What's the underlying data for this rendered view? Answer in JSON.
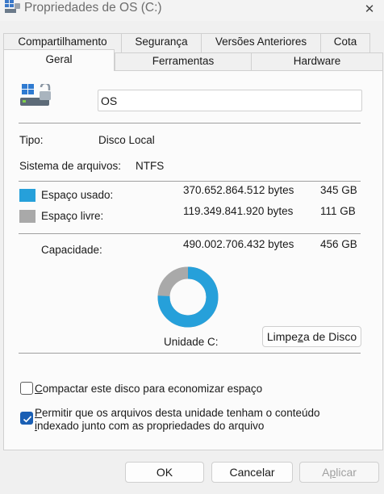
{
  "window": {
    "title": "Propriedades de OS (C:)",
    "close_glyph": "✕"
  },
  "tabs_top": [
    "Compartilhamento",
    "Segurança",
    "Versões Anteriores",
    "Cota"
  ],
  "tabs_bottom": [
    "Geral",
    "Ferramentas",
    "Hardware"
  ],
  "selected_tab": "Geral",
  "drive": {
    "icon": "drive-icon",
    "name_value": "OS"
  },
  "info": {
    "type_label": "Tipo:",
    "type_value": "Disco Local",
    "fs_label": "Sistema de arquivos:",
    "fs_value": "NTFS"
  },
  "space": {
    "used_label": "Espaço usado:",
    "used_bytes": "370.652.864.512 bytes",
    "used_short": "345 GB",
    "used_color": "#26a0da",
    "free_label": "Espaço livre:",
    "free_bytes": "119.349.841.920 bytes",
    "free_short": "111 GB",
    "free_color": "#a9a9a9",
    "capacity_label": "Capacidade:",
    "capacity_bytes": "490.002.706.432 bytes",
    "capacity_short": "456 GB",
    "used_fraction": 0.7564
  },
  "drive_label": "Unidade C:",
  "cleanup_button": {
    "pre": "Limpe",
    "u": "z",
    "post": "a de Disco"
  },
  "options": {
    "compress": {
      "checked": false,
      "u": "C",
      "rest": "ompactar este disco para economizar espaço"
    },
    "index": {
      "checked": true,
      "line1_u": "P",
      "line1_rest": "ermitir que os arquivos desta unidade tenham o conteúdo",
      "line2_u": "i",
      "line2_rest": "ndexado junto com as propriedades do arquivo"
    }
  },
  "buttons": {
    "ok": "OK",
    "cancel": "Cancelar",
    "apply_u": "p",
    "apply_pre": "A",
    "apply_post": "licar"
  }
}
